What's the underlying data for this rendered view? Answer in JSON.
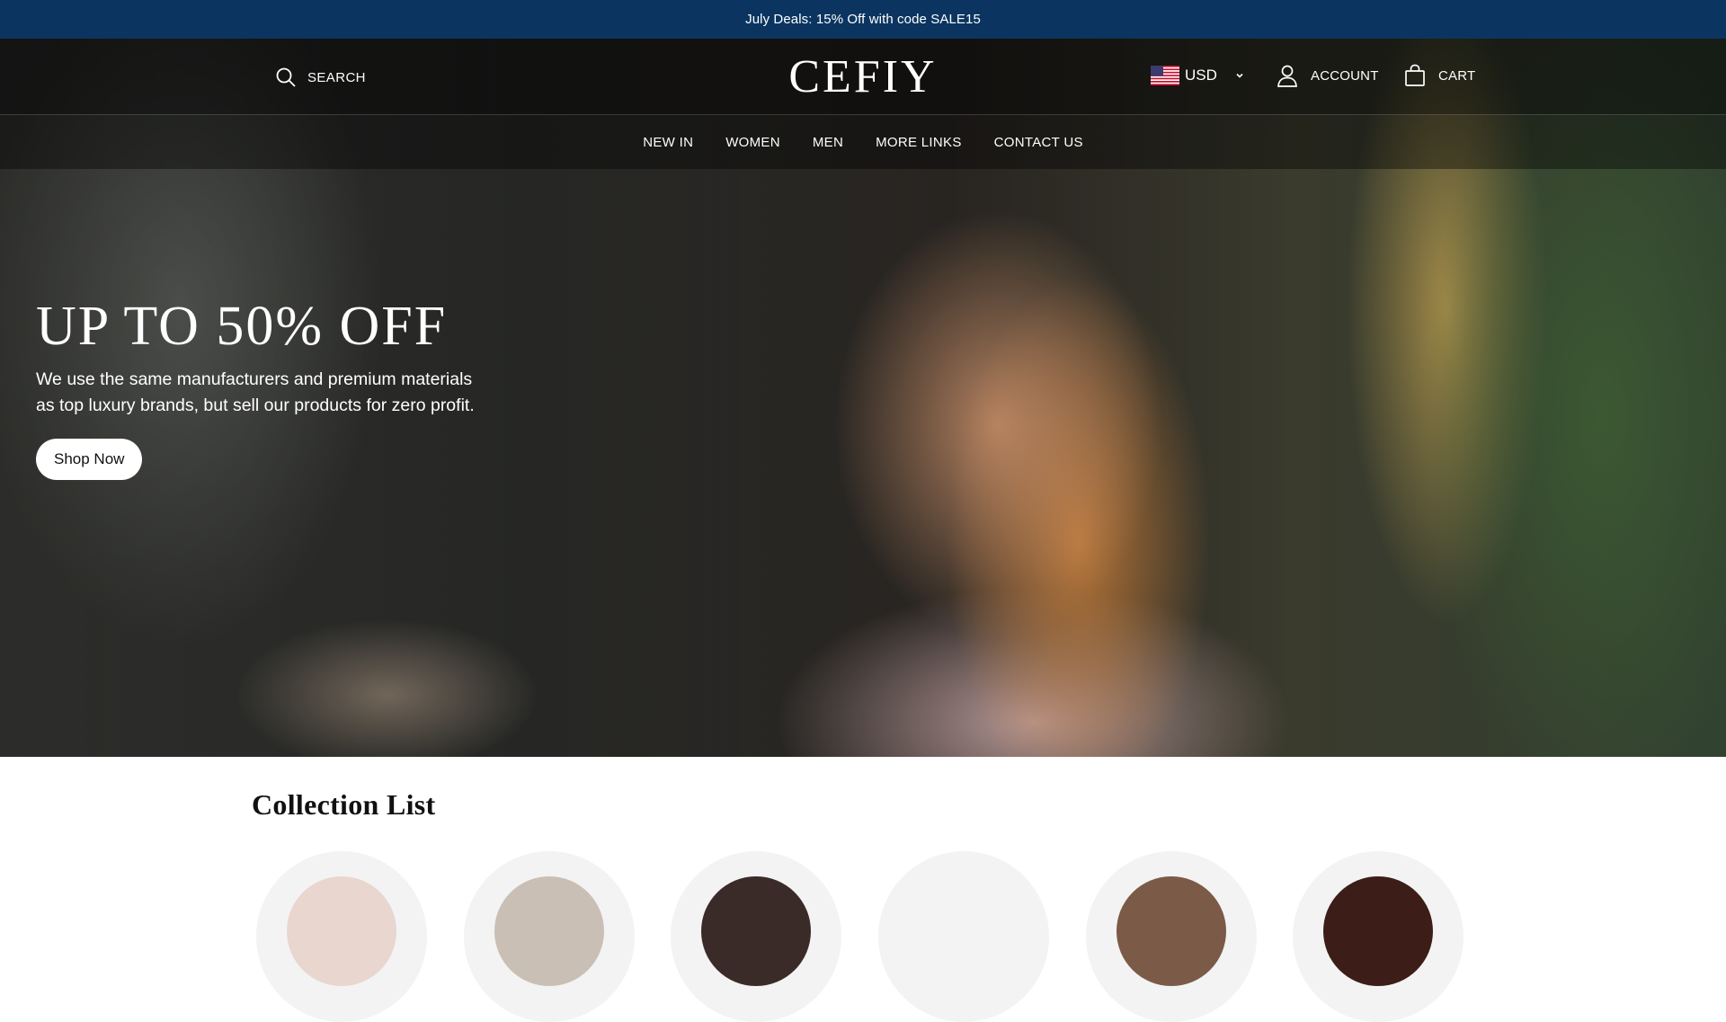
{
  "announcement": {
    "text": "July Deals: 15% Off with code SALE15"
  },
  "header": {
    "search_label": "SEARCH",
    "logo_text": "CEFIY",
    "currency": {
      "code": "USD",
      "flag_icon": "us-flag-icon"
    },
    "account_label": "ACCOUNT",
    "cart_label": "CART"
  },
  "nav": {
    "items": [
      {
        "label": "NEW IN"
      },
      {
        "label": "WOMEN"
      },
      {
        "label": "MEN"
      },
      {
        "label": "MORE LINKS"
      },
      {
        "label": "CONTACT US"
      }
    ]
  },
  "hero": {
    "title": "UP TO 50% OFF",
    "text": "We use the same manufacturers and premium materials as top luxury brands, but sell our products for zero profit.",
    "cta_label": "Shop Now"
  },
  "collection": {
    "title": "Collection List",
    "items": [
      {
        "thumb_color": "#e8d6cf"
      },
      {
        "thumb_color": "#c9bfb4"
      },
      {
        "thumb_color": "#3a2b28"
      },
      {
        "thumb_color": "#f3f3f3"
      },
      {
        "thumb_color": "#7b5a48"
      },
      {
        "thumb_color": "#3c1d18"
      }
    ]
  },
  "colors": {
    "announcement_bg": "#0b3560",
    "text_light": "#ffffff",
    "text_dark": "#111111"
  }
}
